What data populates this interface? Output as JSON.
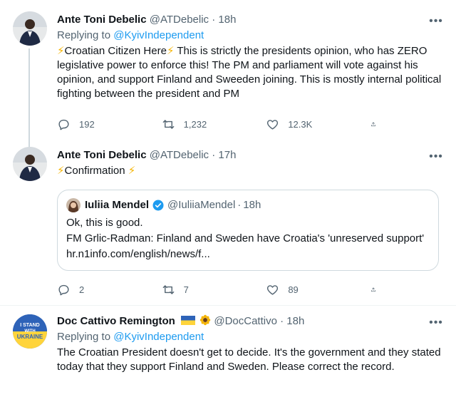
{
  "tweets": [
    {
      "author_name": "Ante Toni Debelic",
      "author_handle": "@ATDebelic",
      "time": "18h",
      "replying_prefix": "Replying to ",
      "replying_to": "@KyivIndependent",
      "text_bolt_a": "⚡",
      "text_lead": "Croatian Citizen Here",
      "text_bolt_b": "⚡",
      "text_rest": " This is strictly the presidents opinion, who has ZERO legislative power to enforce this! The PM and parliament will vote against his opinion, and support Finland and Sweeden joining. This is mostly internal political fighting between the president and PM",
      "replies": "192",
      "retweets": "1,232",
      "likes": "12.3K"
    },
    {
      "author_name": "Ante Toni Debelic",
      "author_handle": "@ATDebelic",
      "time": "17h",
      "text_bolt_a": "⚡",
      "text_lead": "Confirmation",
      "text_bolt_b": "⚡",
      "quote": {
        "author_name": "Iuliia Mendel",
        "author_handle": "@IuliiaMendel",
        "time": "18h",
        "line1": "Ok, this is good.",
        "line2": "FM Grlic-Radman: Finland and Sweden have Croatia's 'unreserved support' hr.n1info.com/english/news/f..."
      },
      "replies": "2",
      "retweets": "7",
      "likes": "89"
    },
    {
      "author_name": "Doc Cattivo Remington",
      "author_handle": "@DocCattivo",
      "time": "18h",
      "replying_prefix": "Replying to ",
      "replying_to": "@KyivIndependent",
      "avatar_text_1": "I STAND",
      "avatar_text_2": "WITH",
      "avatar_text_3": "UKRAINE",
      "text": "The Croatian President doesn't get to decide. It's the government and they stated today that they support Finland and Sweden. Please correct the record."
    }
  ],
  "separator": "·",
  "more_glyph": "•••",
  "colors": {
    "accent": "#1d9bf0",
    "muted": "#536471",
    "border": "#cfd9de",
    "bolt": "#f5b400"
  }
}
